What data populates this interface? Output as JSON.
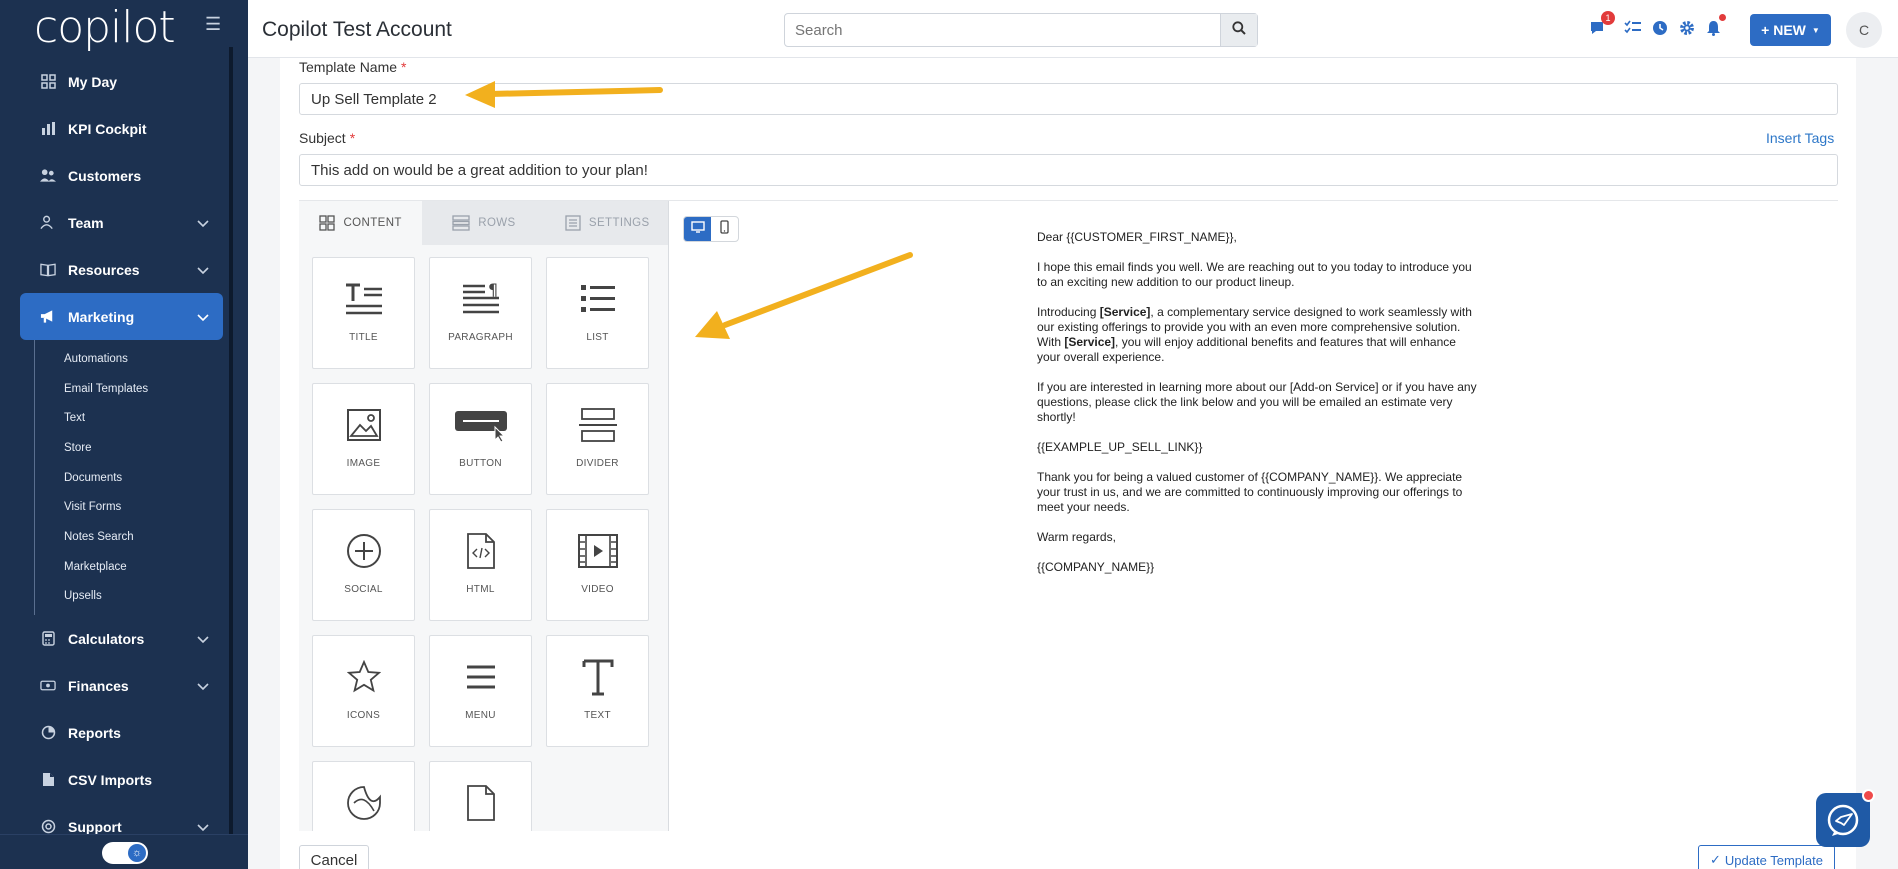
{
  "sidebar": {
    "logo": "copilot",
    "items": [
      {
        "label": "My Day",
        "icon": "grid-icon"
      },
      {
        "label": "KPI Cockpit",
        "icon": "bar-chart-icon"
      },
      {
        "label": "Customers",
        "icon": "users-icon"
      },
      {
        "label": "Team",
        "icon": "user-group-icon"
      },
      {
        "label": "Resources",
        "icon": "book-icon"
      },
      {
        "label": "Marketing",
        "icon": "megaphone-icon"
      }
    ],
    "marketing_sub": [
      "Automations",
      "Email Templates",
      "Text",
      "Store",
      "Documents",
      "Visit Forms",
      "Notes Search",
      "Marketplace",
      "Upsells"
    ],
    "items_after": [
      {
        "label": "Calculators",
        "icon": "calculator-icon"
      },
      {
        "label": "Finances",
        "icon": "money-icon"
      },
      {
        "label": "Reports",
        "icon": "pie-chart-icon"
      },
      {
        "label": "CSV Imports",
        "icon": "file-icon"
      },
      {
        "label": "Support",
        "icon": "support-icon"
      }
    ]
  },
  "header": {
    "title": "Copilot Test Account",
    "search_placeholder": "Search",
    "notification_count": "1",
    "new_button": "+ NEW",
    "avatar_initial": "C"
  },
  "form": {
    "template_name_label": "Template Name",
    "template_name_value": "Up Sell Template 2",
    "subject_label": "Subject",
    "subject_value": "This add on would be a great addition to your plan!",
    "insert_tags": "Insert Tags",
    "required_mark": "*"
  },
  "builder": {
    "tabs": [
      "CONTENT",
      "ROWS",
      "SETTINGS"
    ],
    "tiles": [
      "TITLE",
      "PARAGRAPH",
      "LIST",
      "IMAGE",
      "BUTTON",
      "DIVIDER",
      "SOCIAL",
      "HTML",
      "VIDEO",
      "ICONS",
      "MENU",
      "TEXT",
      "",
      ""
    ]
  },
  "email": {
    "greeting": "Dear {{CUSTOMER_FIRST_NAME}},",
    "p1": "I hope this email finds you well. We are reaching out to you today to introduce you to an exciting new addition to our product lineup.",
    "p2_prefix": "Introducing ",
    "service": "[Service]",
    "p2_mid": ", a complementary service designed to work seamlessly with our existing offerings to provide you with an even more comprehensive solution. With ",
    "p2_suffix": ", you will enjoy additional benefits and features that will enhance your overall experience.",
    "p3": "If you are interested in learning more about our [Add-on Service] or if you have any questions, please click the link below and you will be emailed an estimate very shortly!",
    "link_tag": "{{EXAMPLE_UP_SELL_LINK}}",
    "p4": "Thank you for being a valued customer of {{COMPANY_NAME}}. We appreciate your trust in us, and we are committed to continuously improving our offerings to meet your needs.",
    "closing": "Warm regards,",
    "signature": "{{COMPANY_NAME}}"
  },
  "footer": {
    "cancel": "Cancel",
    "update": "Update Template"
  },
  "colors": {
    "sidebar_bg": "#1c3150",
    "accent": "#2d6cc4",
    "arrow": "#f2b01e",
    "badge": "#e23b3b"
  }
}
